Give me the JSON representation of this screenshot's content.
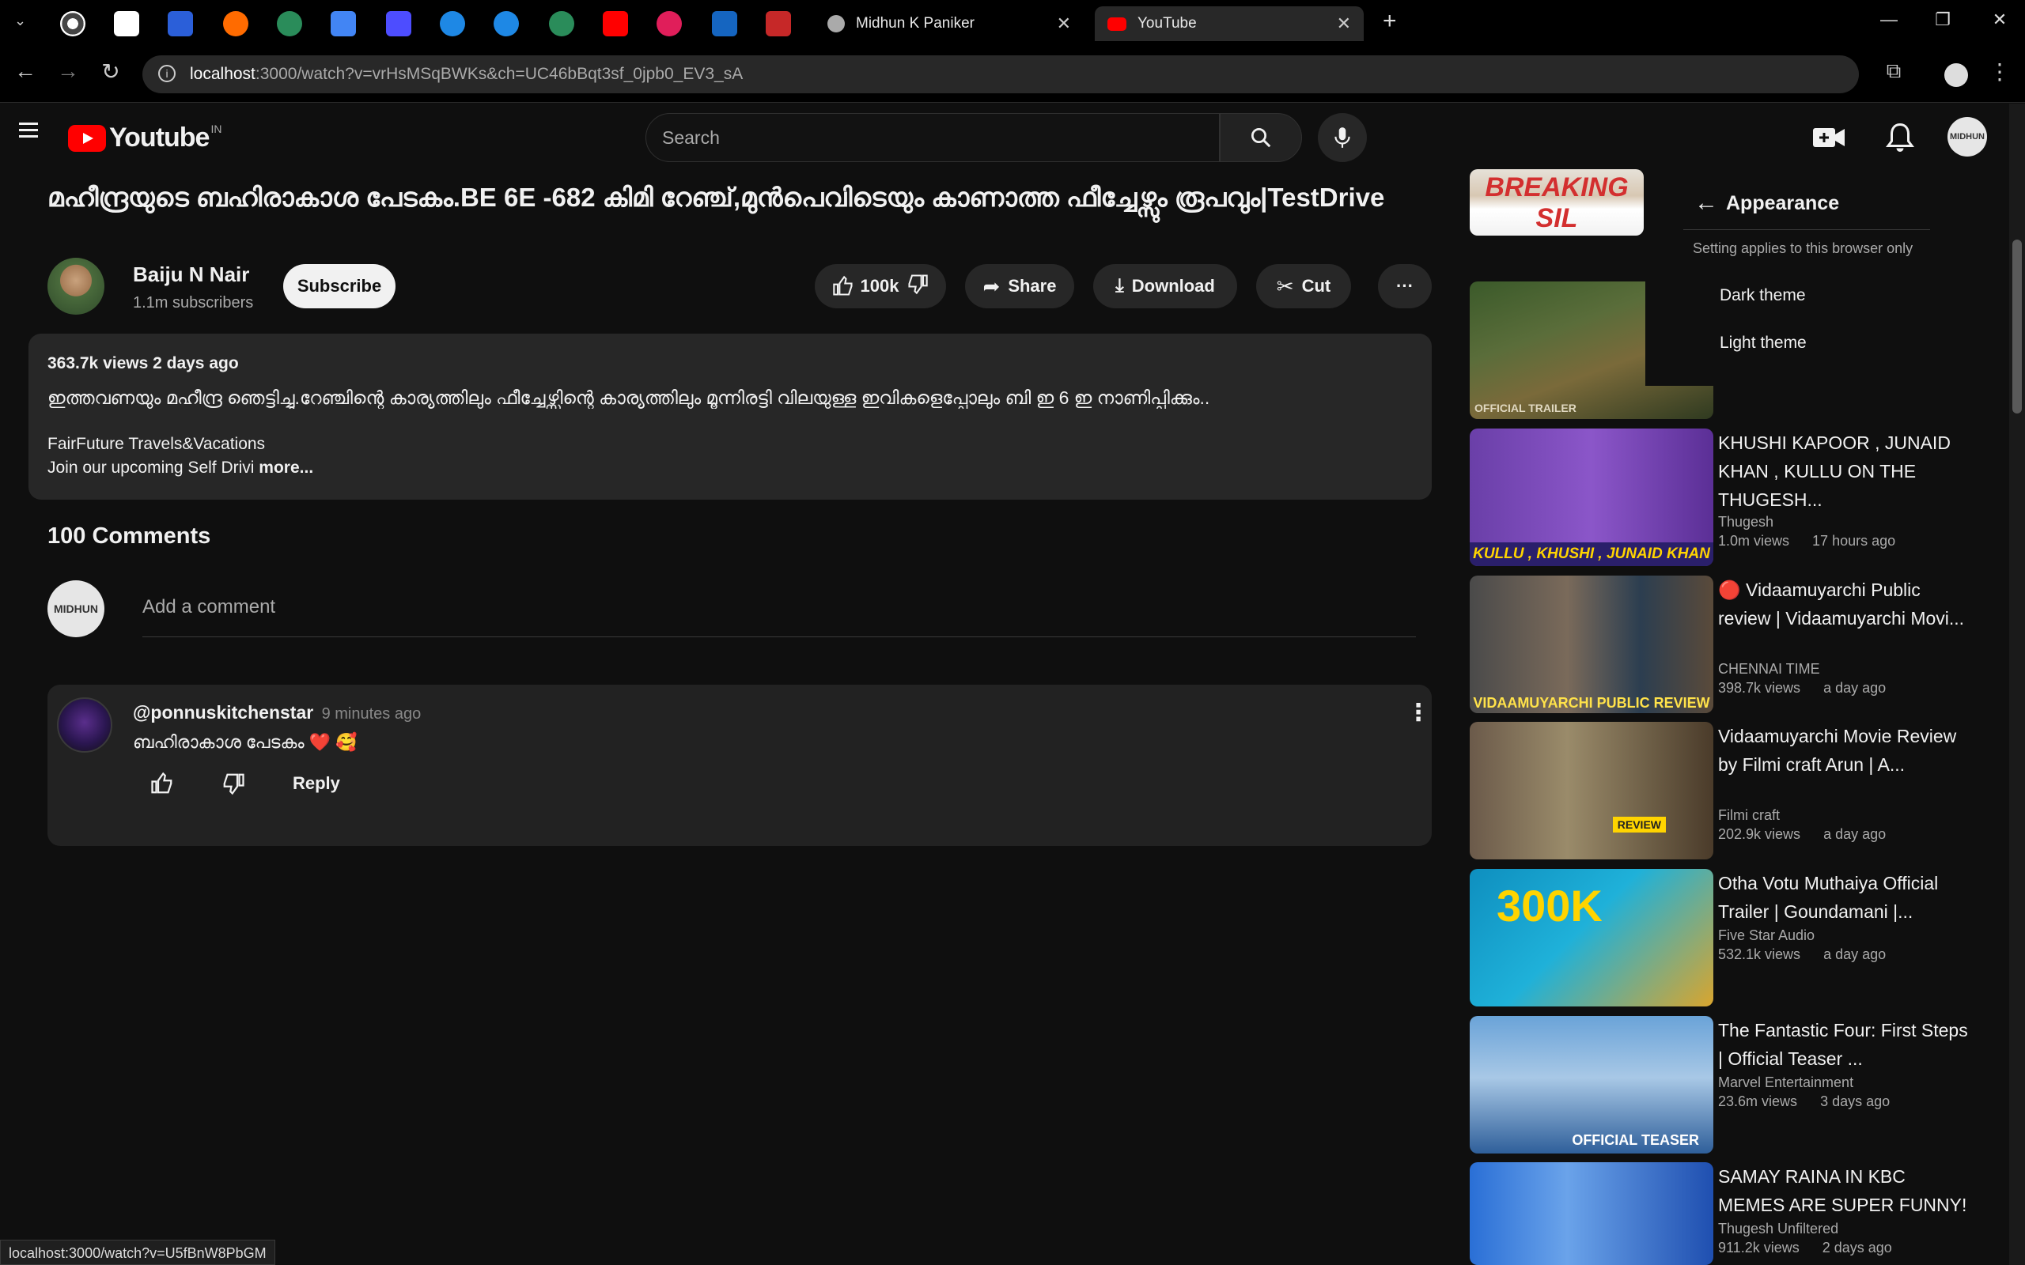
{
  "browser": {
    "tabs": [
      {
        "title": "Midhun K Paniker"
      },
      {
        "title": "YouTube"
      }
    ],
    "url_host": "localhost",
    "url_rest": ":3000/watch?v=vrHsMSqBWKs&ch=UC46bBqt3sf_0jpb0_EV3_sA",
    "status_url": "localhost:3000/watch?v=U5fBnW8PbGM"
  },
  "header": {
    "logo_text": "Youtube",
    "region": "IN",
    "search_placeholder": "Search",
    "avatar_text": "MIDHUN"
  },
  "video": {
    "title": "മഹീന്ദ്രയുടെ ബഹിരാകാശ പേടകം.BE 6E -682 കിമി റേഞ്ച്,മുൻപെവിടെയും കാണാത്ത ഫീച്ചേഴ്സും രൂപവും|TestDrive",
    "channel_name": "Baiju N Nair",
    "subscribers": "1.1m subscribers",
    "subscribe_label": "Subscribe",
    "likes": "100k",
    "share_label": "Share",
    "download_label": "Download",
    "cut_label": "Cut",
    "more_label": "···"
  },
  "description": {
    "meta": "363.7k views 2 days ago",
    "text": "ഇത്തവണയും മഹീന്ദ്ര ഞെട്ടിച്ചു.റേഞ്ചിന്റെ കാര്യത്തിലും ഫീച്ചേഴ്സിന്റെ കാര്യത്തിലും മൂന്നിരട്ടി വിലയുള്ള ഇവികളെപ്പോലും ബി ഇ 6 ഇ നാണിപ്പിക്കും..",
    "line2": "FairFuture Travels&Vacations",
    "line3": "Join our upcoming Self Drivi",
    "more": "more..."
  },
  "comments": {
    "count_label": "100 Comments",
    "add_placeholder": "Add a comment",
    "items": [
      {
        "author": "@ponnuskitchenstar",
        "time": "9 minutes ago",
        "text": "ബഹിരാകാശ പേടകം",
        "emoji": "❤️ 🥰",
        "reply_label": "Reply"
      }
    ]
  },
  "appearance_menu": {
    "title": "Appearance",
    "note": "Setting applies to this browser only",
    "options": [
      "Dark theme",
      "Light theme"
    ]
  },
  "recommendations": [
    {
      "thumb_caption": "BREAKING SIL",
      "title": "",
      "channel": "",
      "views": "",
      "age": ""
    },
    {
      "thumb_caption": "OFFICIAL TRAILER",
      "title": "",
      "channel": "",
      "views": "",
      "age": ""
    },
    {
      "thumb_caption": "KULLU , KHUSHI , JUNAID KHAN",
      "title": "KHUSHI KAPOOR , JUNAID KHAN , KULLU ON THE THUGESH...",
      "channel": "Thugesh",
      "views": "1.0m views",
      "age": "17 hours ago"
    },
    {
      "thumb_caption": "VIDAAMUYARCHI PUBLIC REVIEW",
      "title": "🔴 Vidaamuyarchi Public review | Vidaamuyarchi Movi...",
      "channel": "CHENNAI TIME",
      "views": "398.7k views",
      "age": "a day ago"
    },
    {
      "thumb_caption": "REVIEW",
      "title": "Vidaamuyarchi Movie Review by Filmi craft Arun | A...",
      "channel": "Filmi craft",
      "views": "202.9k views",
      "age": "a day ago"
    },
    {
      "thumb_caption": "300K",
      "title": "Otha Votu Muthaiya Official Trailer | Goundamani |...",
      "channel": "Five Star Audio",
      "views": "532.1k views",
      "age": "a day ago"
    },
    {
      "thumb_caption": "OFFICIAL TEASER",
      "title": "The Fantastic Four: First Steps | Official Teaser ...",
      "channel": "Marvel Entertainment",
      "views": "23.6m views",
      "age": "3 days ago"
    },
    {
      "thumb_caption": "",
      "title": "SAMAY RAINA IN KBC MEMES ARE SUPER FUNNY!",
      "channel": "Thugesh Unfiltered",
      "views": "911.2k views",
      "age": "2 days ago"
    }
  ],
  "colors": {
    "brand_red": "#ff0000",
    "background": "#0f0f0f",
    "surface": "#272727"
  }
}
